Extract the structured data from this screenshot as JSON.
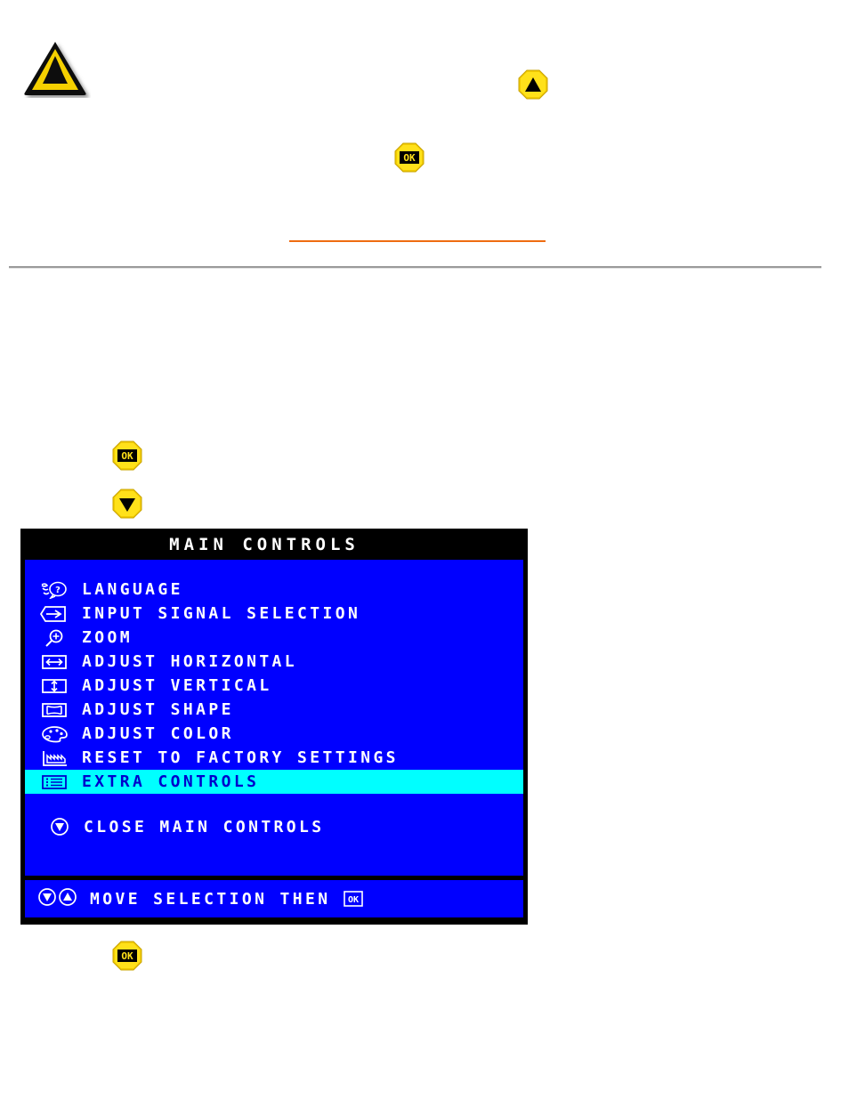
{
  "page": {
    "background_color": "#ffffff",
    "orange_rule_color": "#ef6c11",
    "gray_rule_color": "#9a9a9a"
  },
  "icons": {
    "warning": {
      "name": "warning-triangle-icon",
      "body_color": "#f5d000",
      "border_color": "#000000"
    }
  },
  "buttons": [
    {
      "id": "btn-up-top",
      "name": "osd-up-button",
      "glyph": "up-triangle",
      "label": "",
      "color": "#f2cc00"
    },
    {
      "id": "btn-ok-top",
      "name": "osd-ok-button",
      "glyph": "ok",
      "label": "OK",
      "color": "#f2cc00"
    },
    {
      "id": "btn-ok-mid",
      "name": "osd-ok-button",
      "glyph": "ok",
      "label": "OK",
      "color": "#f2cc00"
    },
    {
      "id": "btn-down-mid",
      "name": "osd-down-button",
      "glyph": "down-triangle",
      "label": "",
      "color": "#f2cc00"
    },
    {
      "id": "btn-ok-bottom",
      "name": "osd-ok-button",
      "glyph": "ok",
      "label": "OK",
      "color": "#f2cc00"
    }
  ],
  "osd": {
    "title": "MAIN CONTROLS",
    "background_color": "#0000ff",
    "title_bar_color": "#000000",
    "highlight_color": "#00ffff",
    "text_color": "#ffffff",
    "highlight_text_color": "#0000cc",
    "menu_items": [
      {
        "icon": "language-icon",
        "label": "LANGUAGE",
        "selected": false
      },
      {
        "icon": "input-signal-icon",
        "label": "INPUT SIGNAL SELECTION",
        "selected": false
      },
      {
        "icon": "zoom-icon",
        "label": "ZOOM",
        "selected": false
      },
      {
        "icon": "horizontal-icon",
        "label": "ADJUST HORIZONTAL",
        "selected": false
      },
      {
        "icon": "vertical-icon",
        "label": "ADJUST VERTICAL",
        "selected": false
      },
      {
        "icon": "shape-icon",
        "label": "ADJUST SHAPE",
        "selected": false
      },
      {
        "icon": "color-palette-icon",
        "label": "ADJUST COLOR",
        "selected": false
      },
      {
        "icon": "factory-reset-icon",
        "label": "RESET TO FACTORY SETTINGS",
        "selected": false
      },
      {
        "icon": "extra-controls-icon",
        "label": "EXTRA CONTROLS",
        "selected": true
      }
    ],
    "close_item": {
      "icon": "down-arrow-icon",
      "label": "CLOSE MAIN CONTROLS"
    },
    "footer": {
      "icons": [
        "down-arrow-icon",
        "up-arrow-icon"
      ],
      "label": "MOVE SELECTION THEN",
      "ok_label": "OK"
    }
  }
}
